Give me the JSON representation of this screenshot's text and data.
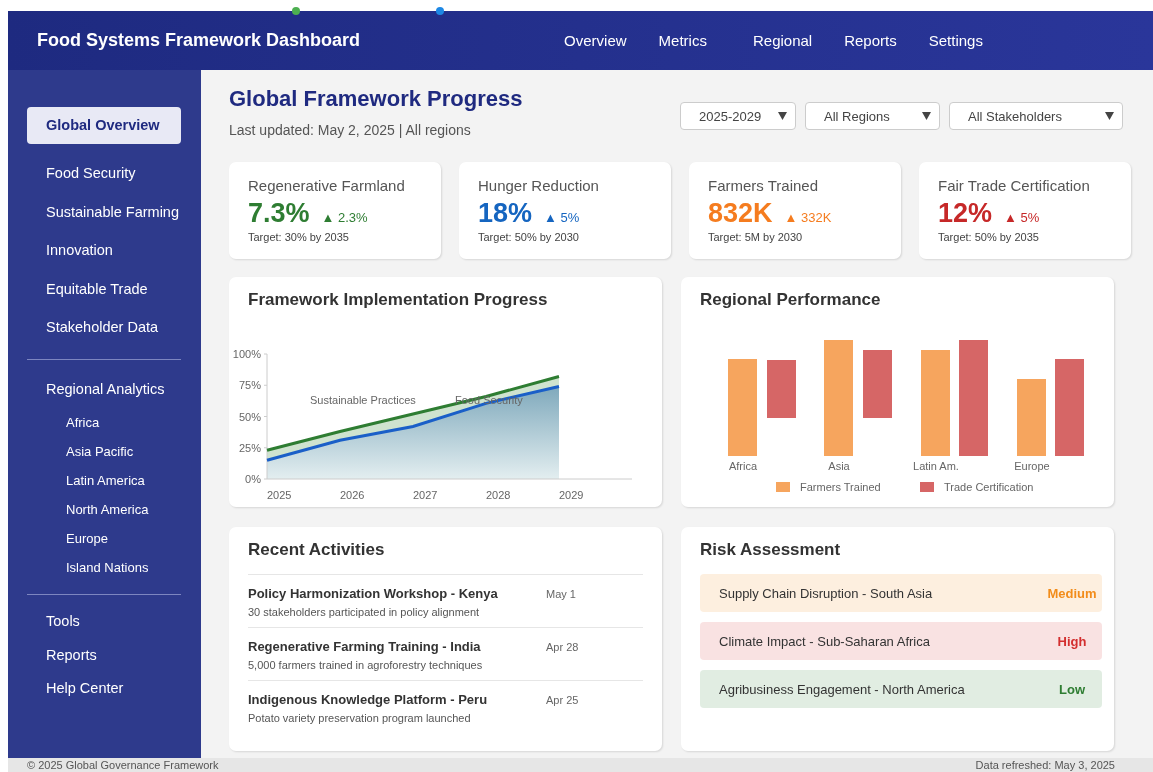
{
  "header": {
    "title": "Food Systems Framework Dashboard",
    "nav": [
      {
        "label": "Overview"
      },
      {
        "label": "Metrics"
      },
      {
        "label": "Regional"
      },
      {
        "label": "Reports"
      },
      {
        "label": "Settings"
      }
    ]
  },
  "sidebar": {
    "main_items": [
      {
        "label": "Global Overview",
        "selected": true
      },
      {
        "label": "Food Security",
        "selected": false
      },
      {
        "label": "Sustainable Farming",
        "selected": false
      },
      {
        "label": "Innovation",
        "selected": false
      },
      {
        "label": "Equitable Trade",
        "selected": false
      },
      {
        "label": "Stakeholder Data",
        "selected": false
      }
    ],
    "regional": {
      "label": "Regional Analytics",
      "children": [
        {
          "label": "Africa"
        },
        {
          "label": "Asia Pacific"
        },
        {
          "label": "Latin America"
        },
        {
          "label": "North America"
        },
        {
          "label": "Europe"
        },
        {
          "label": "Island Nations"
        }
      ]
    },
    "tool_items": [
      {
        "label": "Tools"
      },
      {
        "label": "Reports"
      },
      {
        "label": "Help Center"
      }
    ]
  },
  "page": {
    "title": "Global Framework Progress",
    "subtitle": "Last updated: May 2, 2025 | All regions",
    "filters": [
      {
        "value": "2025-2029"
      },
      {
        "value": "All Regions"
      },
      {
        "value": "All Stakeholders"
      }
    ]
  },
  "kpis": [
    {
      "title": "Regenerative Farmland",
      "value": "7.3%",
      "delta": "▲ 2.3%",
      "target": "Target: 30% by 2035",
      "color": "#2e7d32"
    },
    {
      "title": "Hunger Reduction",
      "value": "18%",
      "delta": "▲ 5%",
      "target": "Target: 50% by 2030",
      "color": "#1565c0"
    },
    {
      "title": "Farmers Trained",
      "value": "832K",
      "delta": "▲ 332K",
      "target": "Target: 5M by 2030",
      "color": "#f57c1f"
    },
    {
      "title": "Fair Trade Certification",
      "value": "12%",
      "delta": "▲ 5%",
      "target": "Target: 50% by 2035",
      "color": "#c62828"
    }
  ],
  "implementation": {
    "title": "Framework Implementation Progress",
    "chart_data": {
      "type": "area",
      "x": [
        "2025",
        "2026",
        "2027",
        "2028",
        "2029"
      ],
      "ylim": [
        0,
        100
      ],
      "yticks": [
        {
          "value": 0,
          "label": "0%"
        },
        {
          "value": 25,
          "label": "25%"
        },
        {
          "value": 50,
          "label": "50%"
        },
        {
          "value": 75,
          "label": "75%"
        },
        {
          "value": 100,
          "label": "100%"
        }
      ],
      "series": [
        {
          "name": "Sustainable Practices",
          "color": "#2e7d32",
          "values": [
            23,
            38,
            52,
            66,
            82
          ]
        },
        {
          "name": "Food Security",
          "color": "#1a5fc8",
          "values": [
            15,
            31,
            42,
            60.5,
            74
          ]
        }
      ]
    }
  },
  "regional_performance": {
    "title": "Regional Performance",
    "categories": [
      "Africa",
      "Asia",
      "Latin Am.",
      "Europe"
    ],
    "legend": [
      {
        "name": "Farmers Trained",
        "color": "#f6a55e"
      },
      {
        "name": "Trade Certification",
        "color": "#d66666"
      }
    ]
  },
  "activities": {
    "title": "Recent Activities",
    "items": [
      {
        "title": "Policy Harmonization Workshop - Kenya",
        "date": "May 1",
        "description": "30 stakeholders participated in policy alignment"
      },
      {
        "title": "Regenerative Farming Training - India",
        "date": "Apr 28",
        "description": "5,000 farmers trained in agroforestry techniques"
      },
      {
        "title": "Indigenous Knowledge Platform - Peru",
        "date": "Apr 25",
        "description": "Potato variety preservation program launched"
      }
    ]
  },
  "risks": {
    "title": "Risk Assessment",
    "items": [
      {
        "label": "Supply Chain Disruption - South Asia",
        "rating": "Medium",
        "color": "#f28c1a"
      },
      {
        "label": "Climate Impact - Sub-Saharan Africa",
        "rating": "High",
        "color": "#d32f2f"
      },
      {
        "label": "Agribusiness Engagement - North America",
        "rating": "Low",
        "color": "#2e7d32"
      }
    ]
  },
  "footer": {
    "left": "© 2025 Global Governance Framework",
    "right": "Data refreshed: May 3, 2025"
  }
}
